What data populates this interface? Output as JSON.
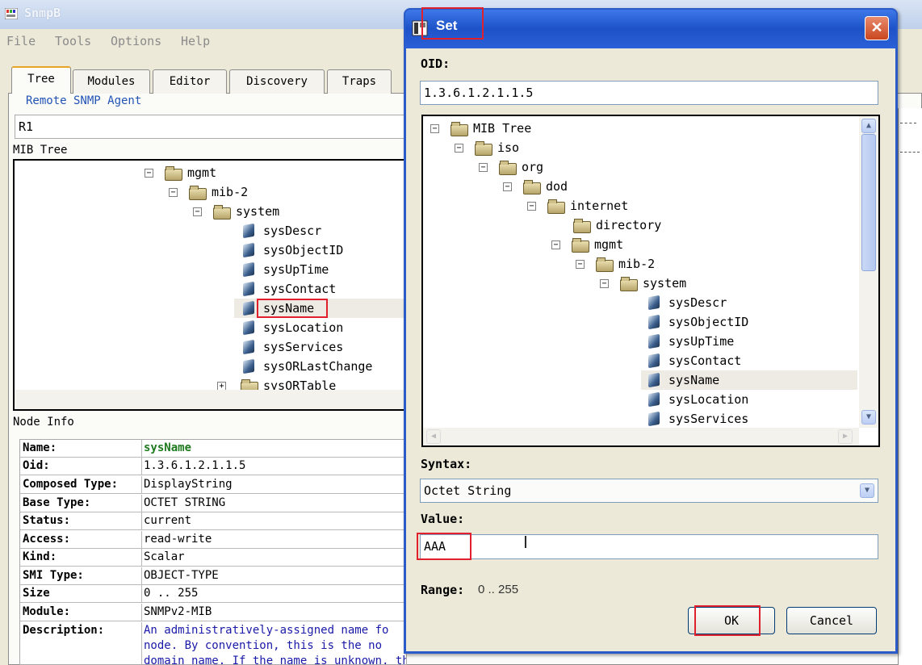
{
  "main": {
    "title": "SnmpB",
    "menu": [
      "File",
      "Tools",
      "Options",
      "Help"
    ],
    "tabs": [
      "Tree",
      "Modules",
      "Editor",
      "Discovery",
      "Traps"
    ],
    "agent_group_label": "Remote SNMP Agent",
    "agent_value": "R1",
    "mib_tree_label": "MIB Tree",
    "tree": {
      "mgmt": "mgmt",
      "mib2": "mib-2",
      "system": "system",
      "leaves": [
        "sysDescr",
        "sysObjectID",
        "sysUpTime",
        "sysContact",
        "sysName",
        "sysLocation",
        "sysServices",
        "sysORLastChange"
      ],
      "table": "sysORTable"
    },
    "node_info_label": "Node Info",
    "node_info": [
      {
        "k": "Name:",
        "v": "sysName"
      },
      {
        "k": "Oid:",
        "v": "1.3.6.1.2.1.1.5"
      },
      {
        "k": "Composed Type:",
        "v": "DisplayString"
      },
      {
        "k": "Base Type:",
        "v": "OCTET STRING"
      },
      {
        "k": "Status:",
        "v": "current"
      },
      {
        "k": "Access:",
        "v": "read-write"
      },
      {
        "k": "Kind:",
        "v": "Scalar"
      },
      {
        "k": "SMI Type:",
        "v": "OBJECT-TYPE"
      },
      {
        "k": "Size",
        "v": "0 .. 255"
      },
      {
        "k": "Module:",
        "v": "SNMPv2-MIB"
      },
      {
        "k": "Description:",
        "v": "An administratively-assigned name fo"
      }
    ],
    "desc_more": [
      "node.  By convention, this is the no",
      "domain name.  If the name is unknown, the value is"
    ]
  },
  "dialog": {
    "title": "Set",
    "close": "✕",
    "oid_label": "OID:",
    "oid_value": "1.3.6.1.2.1.1.5",
    "tree": {
      "root": "MIB Tree",
      "iso": "iso",
      "org": "org",
      "dod": "dod",
      "internet": "internet",
      "directory": "directory",
      "mgmt": "mgmt",
      "mib2": "mib-2",
      "system": "system",
      "leaves": [
        "sysDescr",
        "sysObjectID",
        "sysUpTime",
        "sysContact",
        "sysName",
        "sysLocation",
        "sysServices"
      ]
    },
    "syntax_label": "Syntax:",
    "syntax_value": "Octet String",
    "value_label": "Value:",
    "value_value": "AAA",
    "range_label": "Range:",
    "range_value": "0 .. 255",
    "ok": "OK",
    "cancel": "Cancel"
  },
  "colors": {
    "highlight": "#e0202c",
    "name_value": "#1e7a1e",
    "desc_text": "#1a1aa8"
  }
}
